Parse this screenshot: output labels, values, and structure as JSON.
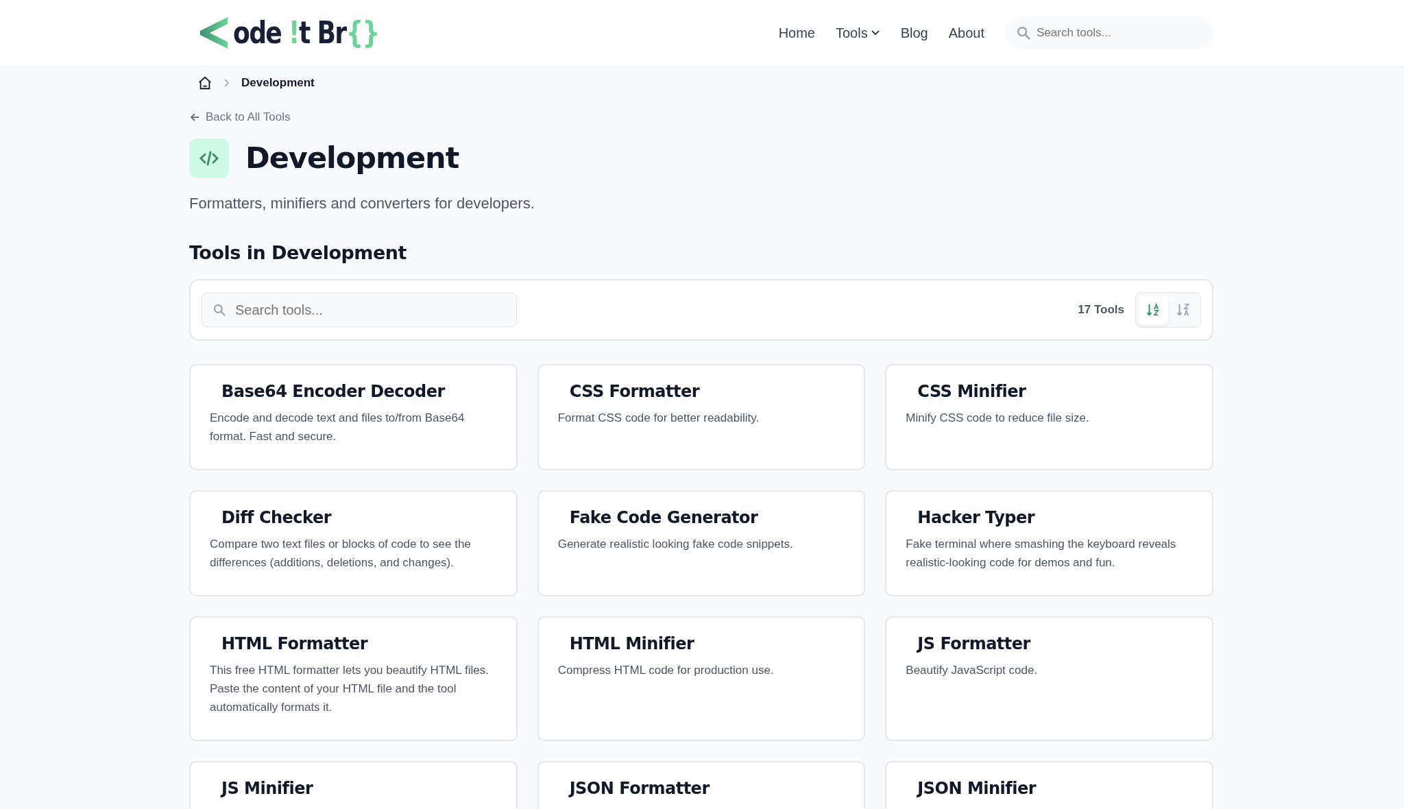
{
  "logo": {
    "parts": [
      {
        "text": "ode ",
        "accent": false
      },
      {
        "text": "!",
        "accent": true
      },
      {
        "text": "t Br",
        "accent": false
      },
      {
        "text": "{}",
        "accent": true
      }
    ]
  },
  "nav": [
    {
      "label": "Home",
      "dropdown": false
    },
    {
      "label": "Tools",
      "dropdown": true
    },
    {
      "label": "Blog",
      "dropdown": false
    },
    {
      "label": "About",
      "dropdown": false
    }
  ],
  "header_search": {
    "placeholder": "Search tools..."
  },
  "breadcrumb": {
    "current": "Development"
  },
  "back_link": "Back to All Tools",
  "page_title": "Development",
  "subtitle": "Formatters, minifiers and converters for developers.",
  "section_title": "Tools in Development",
  "toolbar": {
    "search": {
      "placeholder": "Search tools..."
    },
    "count": "17 Tools",
    "sort_buttons": [
      {
        "kind": "asc",
        "selected": true
      },
      {
        "kind": "desc",
        "selected": false
      }
    ]
  },
  "tools": [
    {
      "title": "Base64 Encoder Decoder",
      "description": "Encode and decode text and files to/from Base64 format. Fast and secure."
    },
    {
      "title": "CSS Formatter",
      "description": "Format CSS code for better readability."
    },
    {
      "title": "CSS Minifier",
      "description": "Minify CSS code to reduce file size."
    },
    {
      "title": "Diff Checker",
      "description": "Compare two text files or blocks of code to see the differences (additions, deletions, and changes)."
    },
    {
      "title": "Fake Code Generator",
      "description": "Generate realistic looking fake code snippets."
    },
    {
      "title": "Hacker Typer",
      "description": "Fake terminal where smashing the keyboard reveals realistic-looking code for demos and fun."
    },
    {
      "title": "HTML Formatter",
      "description": "This free HTML formatter lets you beautify HTML files. Paste the content of your HTML file and the tool automatically formats it."
    },
    {
      "title": "HTML Minifier",
      "description": "Compress HTML code for production use."
    },
    {
      "title": "JS Formatter",
      "description": "Beautify JavaScript code."
    },
    {
      "title": "JS Minifier"
    },
    {
      "title": "JSON Formatter"
    },
    {
      "title": "JSON Minifier"
    }
  ]
}
